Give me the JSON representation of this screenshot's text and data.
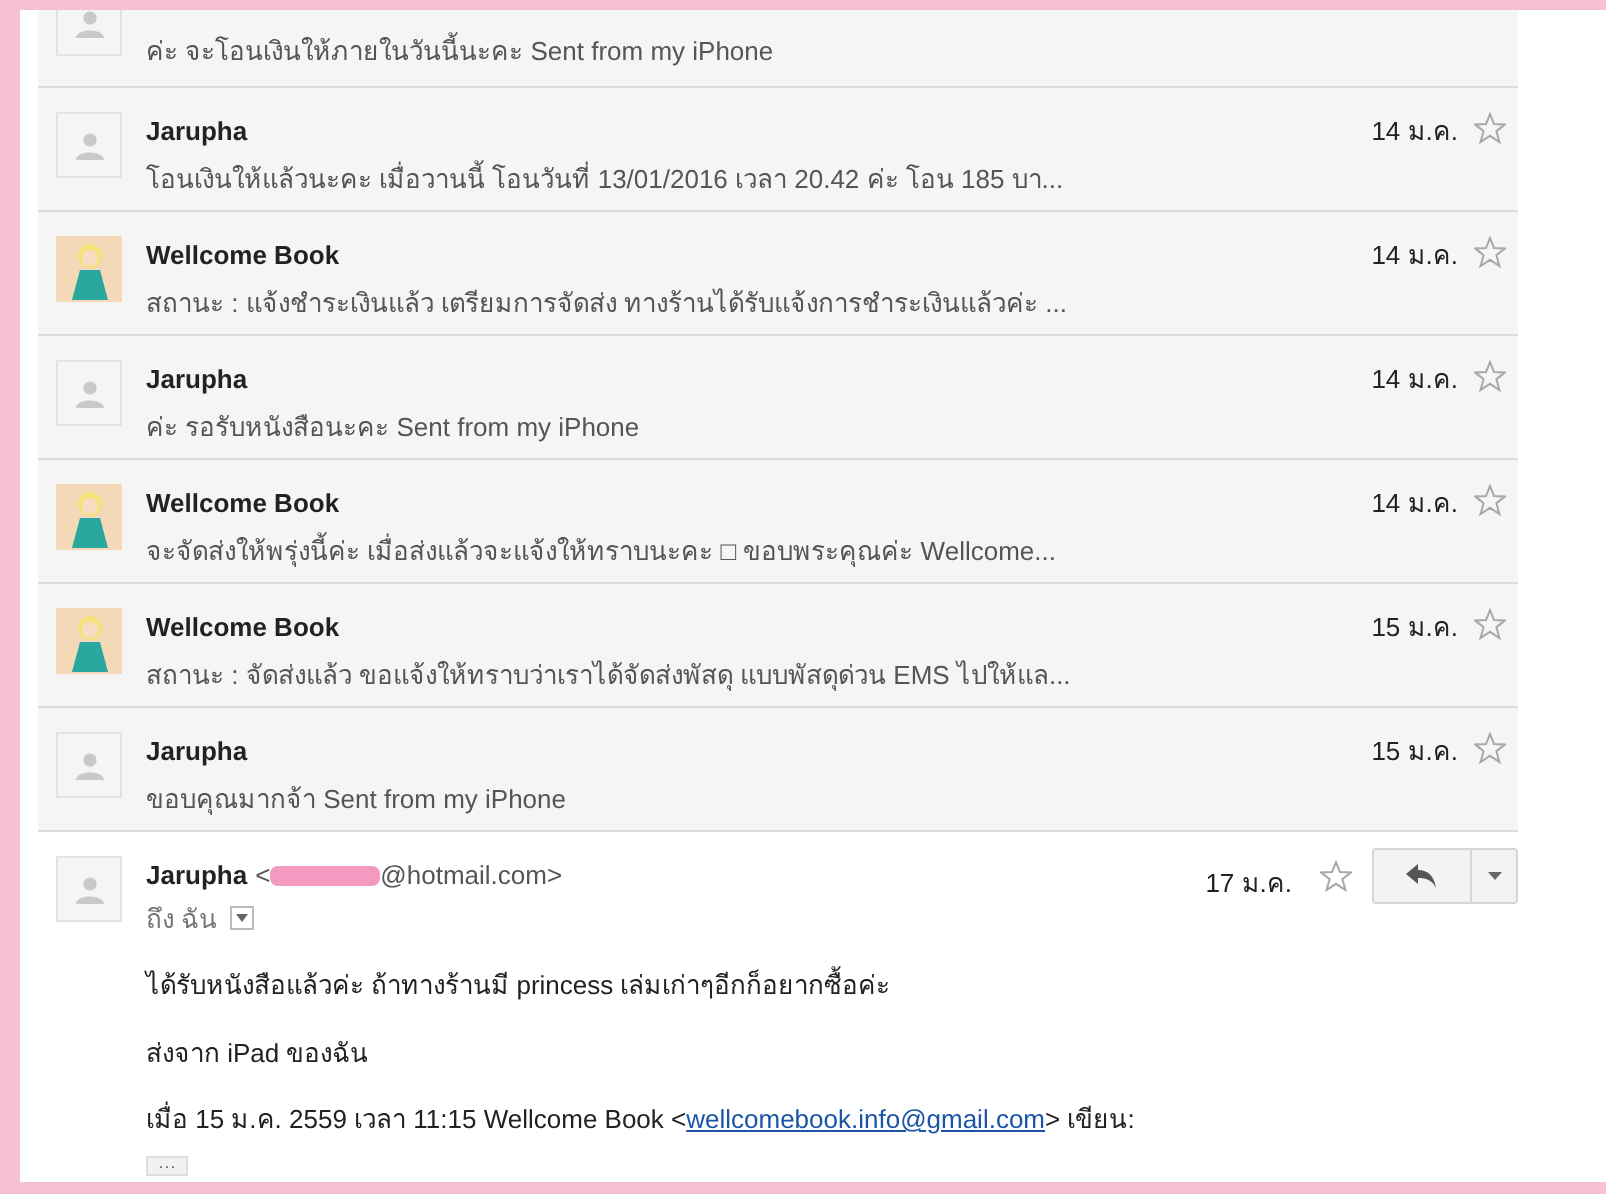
{
  "messages": [
    {
      "snippet": "ค่ะ จะโอนเงินให้ภายในวันนี้นะคะ Sent from my iPhone",
      "kind": "person"
    },
    {
      "sender": "Jarupha",
      "date": "14 ม.ค.",
      "snippet": "โอนเงินให้แล้วนะคะ เมื่อวานนี้ โอนวันที่ 13/01/2016 เวลา 20.42 ค่ะ โอน 185 บา...",
      "kind": "person",
      "starred": false
    },
    {
      "sender": "Wellcome Book",
      "date": "14 ม.ค.",
      "snippet": "สถานะ : แจ้งชำระเงินแล้ว เตรียมการจัดส่ง ทางร้านได้รับแจ้งการชำระเงินแล้วค่ะ ...",
      "kind": "cartoon",
      "starred": false
    },
    {
      "sender": "Jarupha",
      "date": "14 ม.ค.",
      "snippet": "ค่ะ รอรับหนังสือนะคะ Sent from my iPhone",
      "kind": "person",
      "starred": false
    },
    {
      "sender": "Wellcome Book",
      "date": "14 ม.ค.",
      "snippet": "จะจัดส่งให้พรุ่งนี้ค่ะ เมื่อส่งแล้วจะแจ้งให้ทราบนะคะ □ ขอบพระคุณค่ะ Wellcome...",
      "kind": "cartoon",
      "starred": false
    },
    {
      "sender": "Wellcome Book",
      "date": "15 ม.ค.",
      "snippet": "สถานะ : จัดส่งแล้ว ขอแจ้งให้ทราบว่าเราได้จัดส่งพัสดุ แบบพัสดุด่วน EMS ไปให้แล...",
      "kind": "cartoon",
      "starred": false
    },
    {
      "sender": "Jarupha",
      "date": "15 ม.ค.",
      "snippet": "ขอบคุณมากจ้า Sent from my iPhone",
      "kind": "person",
      "starred": false
    }
  ],
  "open_message": {
    "sender": "Jarupha",
    "email_start": "<",
    "email_end": "@hotmail.com>",
    "date": "17 ม.ค.",
    "starred": false,
    "to": "ถึง ฉัน",
    "body": [
      "ได้รับหนังสือแล้วค่ะ ถ้าทางร้านมี princess เล่มเก่าๆอีกก็อยากซื้อค่ะ",
      "ส่งจาก iPad ของฉัน"
    ],
    "quote_before": "เมื่อ 15 ม.ค. 2559 เวลา 11:15 Wellcome Book <",
    "quote_link": "wellcomebook.info@gmail.com",
    "quote_after": "> เขียน:",
    "more": "···"
  }
}
